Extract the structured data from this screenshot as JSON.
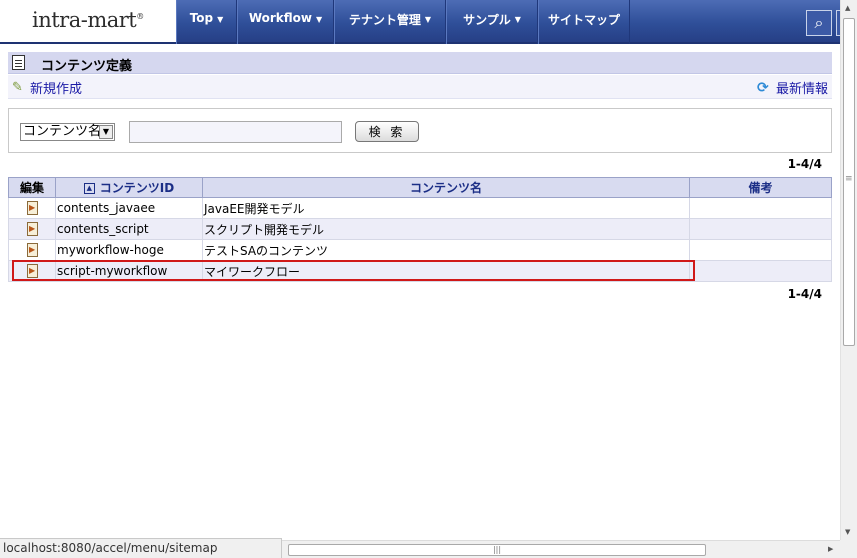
{
  "header": {
    "logo_text": "intra-mart",
    "menu": [
      {
        "label": "Top",
        "caret": true
      },
      {
        "label": "Workflow",
        "caret": true
      },
      {
        "label": "テナント管理",
        "caret": true
      },
      {
        "label": "サンプル",
        "caret": true
      },
      {
        "label": "サイトマップ",
        "caret": false
      }
    ],
    "search_icon": "magnifier-icon"
  },
  "page": {
    "title": "コンテンツ定義",
    "new_label": "新規作成",
    "refresh_label": "最新情報"
  },
  "search": {
    "field_select": "コンテンツ名",
    "input_value": "",
    "button_label": "検 索"
  },
  "pager": {
    "top": "1-4/4",
    "bottom": "1-4/4"
  },
  "table": {
    "headers": {
      "edit": "編集",
      "id": "コンテンツID",
      "name": "コンテンツ名",
      "note": "備考"
    },
    "rows": [
      {
        "id": "contents_javaee",
        "name": "JavaEE開発モデル",
        "note": ""
      },
      {
        "id": "contents_script",
        "name": "スクリプト開発モデル",
        "note": ""
      },
      {
        "id": "myworkflow-hoge",
        "name": "テストSAのコンテンツ",
        "note": ""
      },
      {
        "id": "script-myworkflow",
        "name": "マイワークフロー",
        "note": ""
      }
    ],
    "highlighted_row": 4
  },
  "status_bar": {
    "url": "localhost:8080/accel/menu/sitemap"
  },
  "colors": {
    "nav_bg": "#2f4f99",
    "title_bar": "#d5d7ef",
    "highlight_border": "#d01818",
    "header_text": "#1b2e86"
  }
}
